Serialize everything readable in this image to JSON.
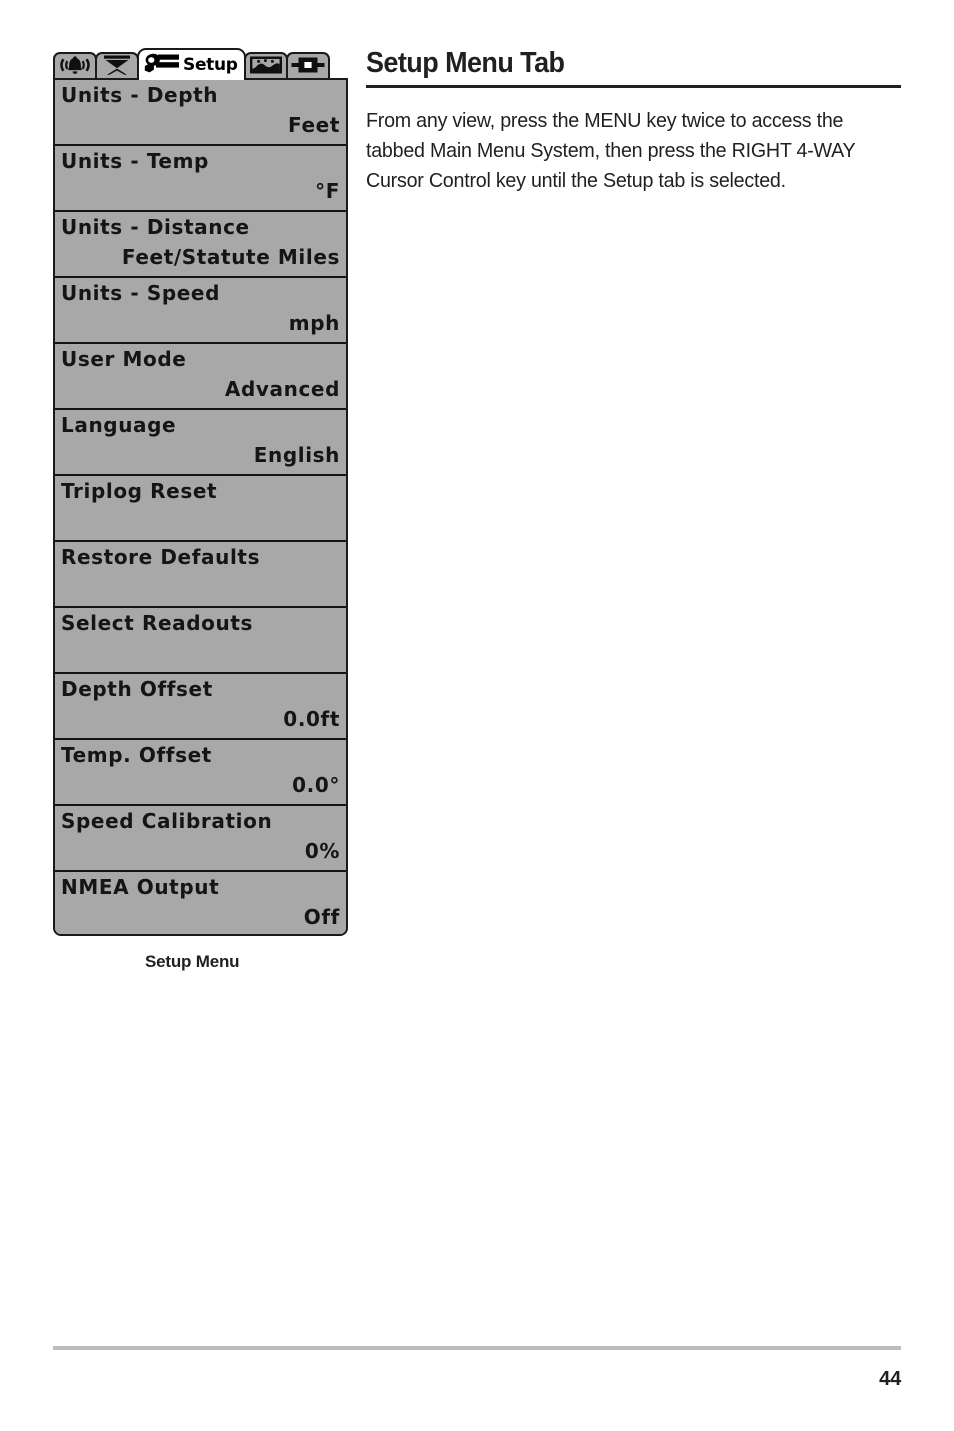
{
  "page": {
    "title": "Setup Menu Tab",
    "number": "44",
    "paragraphs": [
      "From any view, press the MENU key twice to access the tabbed Main Menu System, then press the RIGHT 4-WAY Cursor Control key until the Setup tab is selected."
    ]
  },
  "figure": {
    "caption": "Setup Menu",
    "colors": {
      "lcd_background": "#a8a8a8",
      "lcd_border": "#1a1a1a",
      "lcd_text": "#151515",
      "selected_tab_background": "#ffffff"
    },
    "tabs": [
      {
        "id": "alarms",
        "label": "",
        "icon": "alarm-bell-icon",
        "selected": false
      },
      {
        "id": "sonar",
        "label": "",
        "icon": "sonar-cone-icon",
        "selected": false
      },
      {
        "id": "setup",
        "label": "Setup",
        "icon": "wrench-icon",
        "selected": true
      },
      {
        "id": "views",
        "label": "",
        "icon": "sonar-chart-icon",
        "selected": false
      },
      {
        "id": "accessories",
        "label": "",
        "icon": "display-box-icon",
        "selected": false
      }
    ],
    "menu_items": [
      {
        "name": "Units - Depth",
        "value": "Feet"
      },
      {
        "name": "Units - Temp",
        "value": "°F"
      },
      {
        "name": "Units - Distance",
        "value": "Feet/Statute Miles"
      },
      {
        "name": "Units - Speed",
        "value": "mph"
      },
      {
        "name": "User Mode",
        "value": "Advanced"
      },
      {
        "name": "Language",
        "value": "English"
      },
      {
        "name": "Triplog Reset",
        "value": ""
      },
      {
        "name": "Restore Defaults",
        "value": ""
      },
      {
        "name": "Select Readouts",
        "value": ""
      },
      {
        "name": "Depth Offset",
        "value": "0.0ft"
      },
      {
        "name": "Temp. Offset",
        "value": "0.0°"
      },
      {
        "name": "Speed Calibration",
        "value": "0%"
      },
      {
        "name": "NMEA Output",
        "value": "Off"
      }
    ]
  }
}
